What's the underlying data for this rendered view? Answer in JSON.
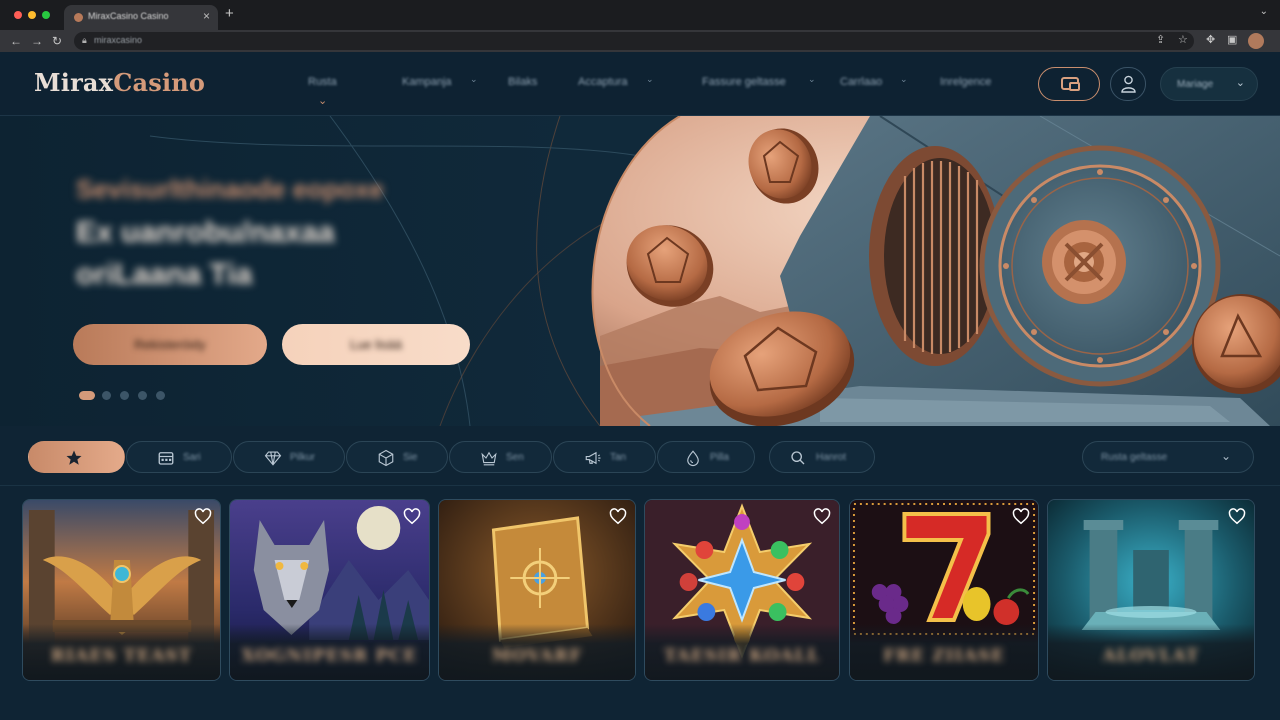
{
  "browser": {
    "tab_title": "MiraxCasino Casino",
    "url": "miraxcasino",
    "new_tab_glyph": "+",
    "close_glyph": "×"
  },
  "site": {
    "logo_part1": "Mirax",
    "logo_part2": "Casino",
    "nav": [
      {
        "label": "Rusta",
        "has_chevron": false,
        "active": true
      },
      {
        "label": "Kampanja",
        "has_chevron": true,
        "active": false
      },
      {
        "label": "Bilaks",
        "has_chevron": false,
        "active": false
      },
      {
        "label": "Accaptura",
        "has_chevron": true,
        "active": false
      },
      {
        "label": "Fassure geltasse",
        "has_chevron": true,
        "active": false
      },
      {
        "label": "Carrlaao",
        "has_chevron": true,
        "active": false
      },
      {
        "label": "Inrelgence",
        "has_chevron": false,
        "active": false
      }
    ],
    "language": "Mariage",
    "wallet_icon": "wallet-icon",
    "user_icon": "user-icon"
  },
  "hero": {
    "eyebrow": "Sevisurlthinaode eopoxe",
    "headline_line1": "Ex uanrobu/naxaa",
    "headline_line2": "oriLaana Tia",
    "primary_button": "Rekisteröidy",
    "secondary_button": "Lue lisää",
    "slides": 5,
    "active_slide": 1,
    "accent": "#d49a7a"
  },
  "filters": {
    "chips": [
      {
        "icon": "star-icon",
        "label": "",
        "active": true
      },
      {
        "icon": "calendar-icon",
        "label": "Sari",
        "active": false
      },
      {
        "icon": "diamond-icon",
        "label": "Pilkur",
        "active": false
      },
      {
        "icon": "dice-icon",
        "label": "Sie",
        "active": false
      },
      {
        "icon": "crown-icon",
        "label": "Sen",
        "active": false
      },
      {
        "icon": "megaphone-icon",
        "label": "Tan",
        "active": false
      },
      {
        "icon": "drop-icon",
        "label": "Pilla",
        "active": false
      },
      {
        "icon": "search-icon",
        "label": "Hanrot",
        "active": false
      }
    ],
    "sort_label": "Rusta geltasse"
  },
  "games": [
    {
      "title": "RIAES TEAST",
      "theme": "eagle"
    },
    {
      "title": "XOGNIPESR PCE",
      "theme": "wolf"
    },
    {
      "title": "MOVARF",
      "theme": "book"
    },
    {
      "title": "TAESIR KOALL",
      "theme": "gem"
    },
    {
      "title": "FRE ZIIASE",
      "theme": "seven"
    },
    {
      "title": "ALOVLAT",
      "theme": "ruins"
    }
  ],
  "colors": {
    "background": "#0f2434",
    "accent": "#d49a7a",
    "accent_light": "#f5d2bb"
  }
}
